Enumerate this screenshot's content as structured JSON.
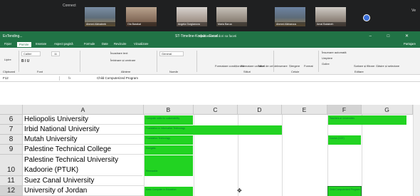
{
  "meeting": {
    "connect": "Connect",
    "right_label": "Ve",
    "participants": [
      "Ahmed Alkhateeb",
      "Ola Barakat",
      "Angela Gorgianova",
      "Maria Barua",
      "Ahmed Alkharous",
      "Amal Bataineh"
    ]
  },
  "excel": {
    "file_title": "ExTending...",
    "window_title": "ST-Timeline-Kodaki - Excel",
    "search_placeholder": "Spunoti ne-ai dori sa faceti",
    "win_controls": "–  □  ✕",
    "tabs": [
      "Fișier",
      "Pornire",
      "Inserare",
      "Aspect pagină",
      "Formule",
      "Date",
      "Revizuire",
      "Vizualizare"
    ],
    "selected_tab": "Pornire",
    "share_label": "Partajare",
    "ribbon": {
      "paste": "Lipire",
      "clipboard_group": "Clipboard",
      "font_name": "Calibri",
      "font_size": "11",
      "font_group": "Font",
      "wrap": "Încadrare text",
      "merge": "Îmbinare și centrare",
      "align_group": "Aliniere",
      "number_format": "General",
      "number_group": "Număr",
      "cond_format": "Formatare condiționată",
      "format_table": "Formatare ca tabel",
      "cell_styles": "Stiluri de celule",
      "styles_group": "Stiluri",
      "insert": "Inserare",
      "delete": "Ștergere",
      "format": "Format",
      "cells_group": "Celule",
      "autosum": "Însumare automată",
      "fill": "Umplere",
      "clear": "Golire",
      "sort": "Sortare și filtrare",
      "find": "Găsire și selectare",
      "edit_group": "Editare"
    },
    "name_box": "F12",
    "fx": "fx",
    "formula_value": "Child Computerized Program",
    "columns": [
      "A",
      "B",
      "C",
      "D",
      "E",
      "F",
      "G"
    ],
    "rows": [
      {
        "num": "6",
        "a": "Heliopolis University"
      },
      {
        "num": "7",
        "a": "Irbid National University"
      },
      {
        "num": "8",
        "a": "Mutah University"
      },
      {
        "num": "9",
        "a": "Palestine Technical College"
      },
      {
        "num": "10",
        "a": "Palestine Technical University Kadoorie (PTUK)"
      },
      {
        "num": "11",
        "a": "Suez Canal University"
      },
      {
        "num": "12",
        "a": "University of Jordan"
      }
    ],
    "green_cells": [
      "Computer skills for sustainability",
      "Foundation in Information Technology",
      "Foundation Technology",
      "Energetic",
      "Renewable",
      "Teachers at Universities",
      "Course (CCE)",
      "Basic Computer in Education",
      "Child Computerized Program"
    ]
  }
}
